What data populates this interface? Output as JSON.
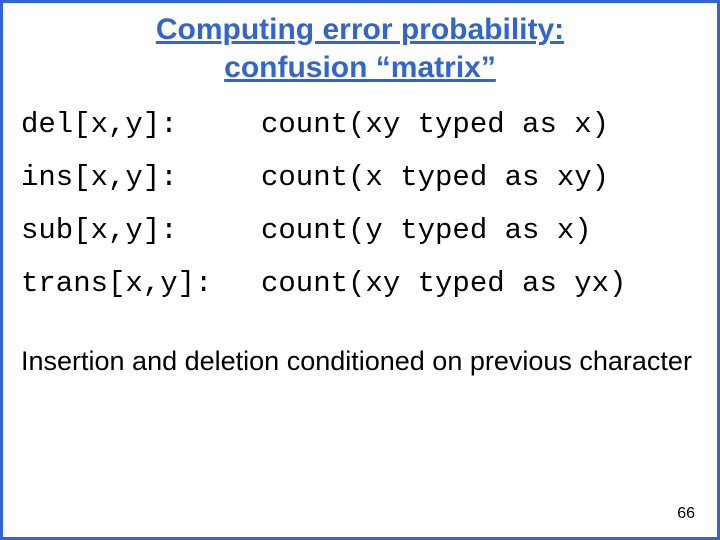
{
  "title_line1": "Computing error probability:",
  "title_line2": "confusion “matrix”",
  "defs": [
    {
      "left": "del[x,y]:",
      "right": "count(xy typed as x)"
    },
    {
      "left": "ins[x,y]:",
      "right": "count(x typed as xy)"
    },
    {
      "left": "sub[x,y]:",
      "right": "count(y typed as x)"
    },
    {
      "left": "trans[x,y]:",
      "right": "count(xy typed as yx)"
    }
  ],
  "note": "Insertion and deletion conditioned on previous character",
  "page_number": "66"
}
